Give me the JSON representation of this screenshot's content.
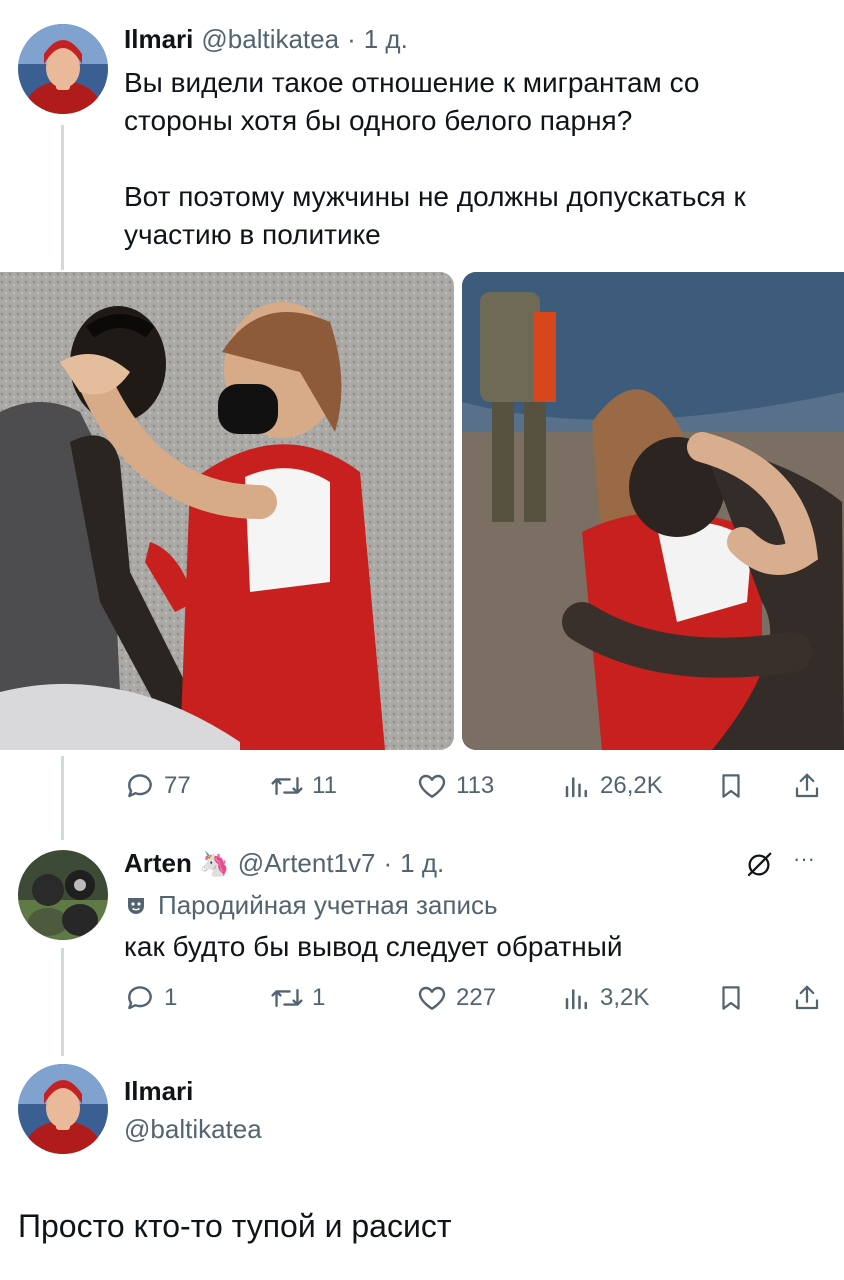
{
  "tweet1": {
    "name": "Ilmari",
    "handle": "@baltikatea",
    "sep": "·",
    "time": "1 д.",
    "text": "Вы видели такое отношение к мигрантам со\nстороны хотя бы одного белого парня?\n\nВот поэтому мужчины не должны допускаться к\nучастию в политике",
    "replies": "77",
    "retweets": "11",
    "likes": "113",
    "views": "26,2K"
  },
  "tweet2": {
    "name": "Arten",
    "emoji": "🦄",
    "handle": "@Artent1v7",
    "sep": "·",
    "time": "1 д.",
    "parody_label": "Пародийная учетная запись",
    "text": "как будто бы вывод следует обратный",
    "replies": "1",
    "retweets": "1",
    "likes": "227",
    "views": "3,2K",
    "more": "···"
  },
  "tweet3": {
    "name": "Ilmari",
    "handle": "@baltikatea",
    "text": "Просто кто-то тупой и расист"
  },
  "colors": {
    "text": "#0f1419",
    "secondary": "#536471",
    "thread_line": "#cfd9de",
    "vest_red": "#c8201e"
  }
}
